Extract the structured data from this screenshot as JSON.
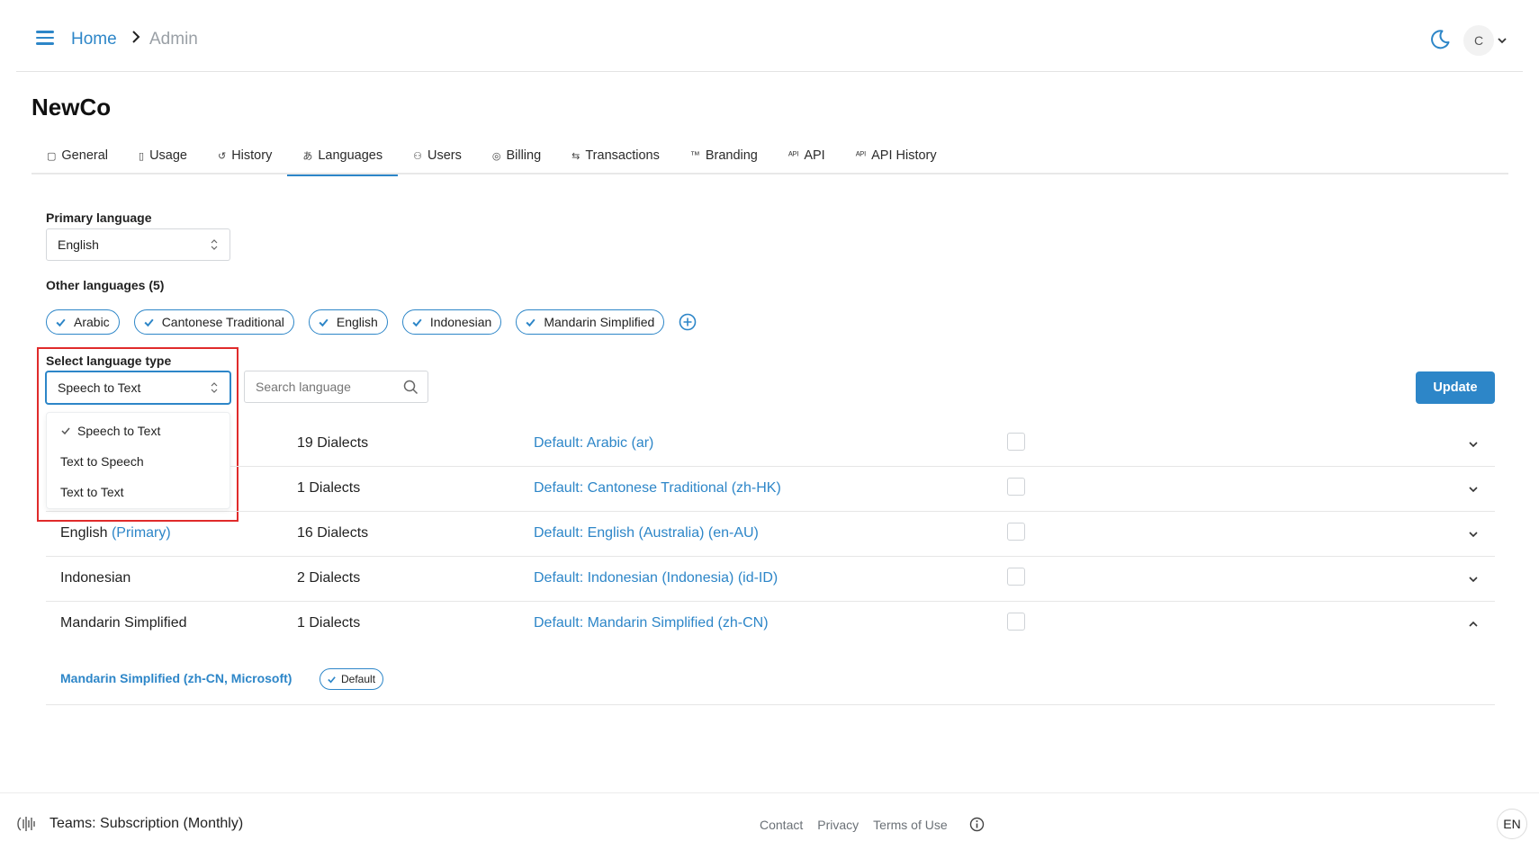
{
  "header": {
    "breadcrumb_home": "Home",
    "breadcrumb_current": "Admin",
    "avatar_initial": "C"
  },
  "page_title": "NewCo",
  "tabs": [
    {
      "label": "General",
      "icon": "square-icon",
      "glyph": "▢"
    },
    {
      "label": "Usage",
      "icon": "battery-icon",
      "glyph": "▯"
    },
    {
      "label": "History",
      "icon": "history-icon",
      "glyph": "↺"
    },
    {
      "label": "Languages",
      "icon": "translate-icon",
      "glyph": "あ",
      "active": true
    },
    {
      "label": "Users",
      "icon": "user-icon",
      "glyph": "⚇"
    },
    {
      "label": "Billing",
      "icon": "coins-icon",
      "glyph": "◎"
    },
    {
      "label": "Transactions",
      "icon": "arrows-icon",
      "glyph": "⇆"
    },
    {
      "label": "Branding",
      "icon": "tm-icon",
      "glyph": "™"
    },
    {
      "label": "API",
      "icon": "api-icon",
      "glyph": "ᴬᴾᴵ"
    },
    {
      "label": "API History",
      "icon": "api-icon",
      "glyph": "ᴬᴾᴵ"
    }
  ],
  "primary_language": {
    "label": "Primary language",
    "value": "English"
  },
  "other_languages": {
    "label": "Other languages (5)",
    "chips": [
      "Arabic",
      "Cantonese Traditional",
      "English",
      "Indonesian",
      "Mandarin Simplified"
    ]
  },
  "language_type": {
    "label": "Select language type",
    "value": "Speech to Text",
    "options": [
      "Speech to Text",
      "Text to Speech",
      "Text to Text"
    ]
  },
  "search": {
    "placeholder": "Search language"
  },
  "update_label": "Update",
  "languages": [
    {
      "name": "",
      "dialects": "19 Dialects",
      "default": "Default: Arabic (ar)",
      "expanded": false
    },
    {
      "name": "",
      "dialects": "1 Dialects",
      "default": "Default: Cantonese Traditional (zh-HK)",
      "expanded": false
    },
    {
      "name": "English",
      "tag": "(Primary)",
      "dialects": "16 Dialects",
      "default": "Default: English (Australia) (en-AU)",
      "expanded": false
    },
    {
      "name": "Indonesian",
      "dialects": "2 Dialects",
      "default": "Default: Indonesian (Indonesia) (id-ID)",
      "expanded": false
    },
    {
      "name": "Mandarin Simplified",
      "dialects": "1 Dialects",
      "default": "Default: Mandarin Simplified (zh-CN)",
      "expanded": true
    }
  ],
  "expanded_detail": {
    "name": "Mandarin Simplified (zh-CN, Microsoft)",
    "badge": "Default"
  },
  "footer": {
    "plan": "Teams: Subscription (Monthly)",
    "links": [
      "Contact",
      "Privacy",
      "Terms of Use"
    ],
    "lang": "EN"
  },
  "colors": {
    "accent": "#2d86c8",
    "highlight_box": "#e02b2b"
  }
}
